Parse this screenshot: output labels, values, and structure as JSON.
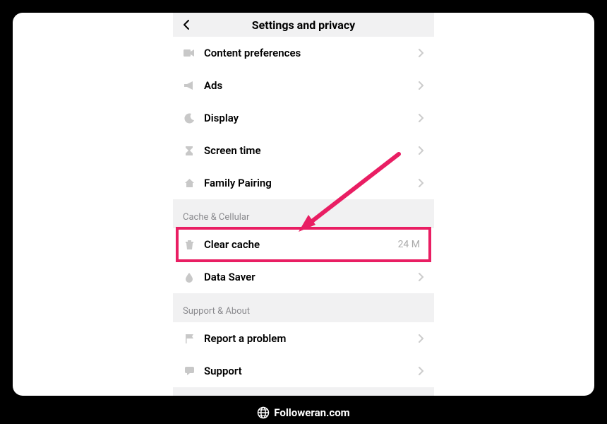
{
  "header": {
    "title": "Settings and privacy"
  },
  "groups": {
    "g1": {
      "items": [
        {
          "label": "Content preferences"
        },
        {
          "label": "Ads"
        },
        {
          "label": "Display"
        },
        {
          "label": "Screen time"
        },
        {
          "label": "Family Pairing"
        }
      ]
    },
    "g2": {
      "title": "Cache & Cellular",
      "items": [
        {
          "label": "Clear cache",
          "value": "24 M"
        },
        {
          "label": "Data Saver"
        }
      ]
    },
    "g3": {
      "title": "Support & About",
      "items": [
        {
          "label": "Report a problem"
        },
        {
          "label": "Support"
        }
      ]
    }
  },
  "footer": {
    "brand": "Followeran.com"
  },
  "annotation": {
    "highlight_color": "#e91e63"
  }
}
